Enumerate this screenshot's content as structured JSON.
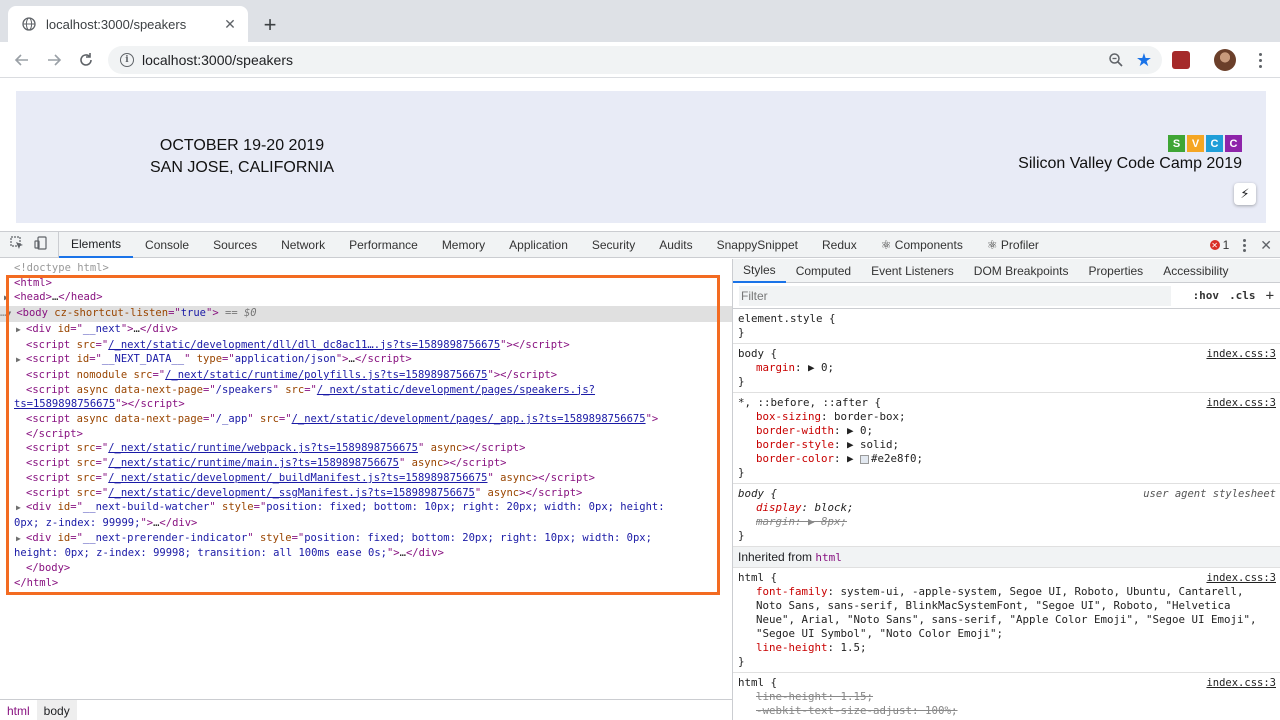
{
  "browser": {
    "tab_title": "localhost:3000/speakers",
    "tab_close": "✕",
    "new_tab": "+",
    "url": "localhost:3000/speakers"
  },
  "page": {
    "dates_line1": "OCTOBER 19-20  2019",
    "dates_line2": "SAN JOSE, CALIFORNIA",
    "logo_letters": [
      "S",
      "V",
      "C",
      "C"
    ],
    "logo_colors": [
      "#3fa535",
      "#f5a623",
      "#1f9ed8",
      "#8e24aa"
    ],
    "title": "Silicon Valley Code Camp 2019"
  },
  "devtools": {
    "tabs": [
      "Elements",
      "Console",
      "Sources",
      "Network",
      "Performance",
      "Memory",
      "Application",
      "Security",
      "Audits",
      "SnappySnippet",
      "Redux",
      "⚛ Components",
      "⚛ Profiler"
    ],
    "active_tab": "Elements",
    "error_count": "1",
    "breadcrumbs": [
      "html",
      "body"
    ],
    "styles_tabs": [
      "Styles",
      "Computed",
      "Event Listeners",
      "DOM Breakpoints",
      "Properties",
      "Accessibility"
    ],
    "filter_placeholder": "Filter",
    "filter_tools": [
      ":hov",
      ".cls",
      "+"
    ],
    "inherited_label": "Inherited from",
    "inherited_from": "html"
  }
}
